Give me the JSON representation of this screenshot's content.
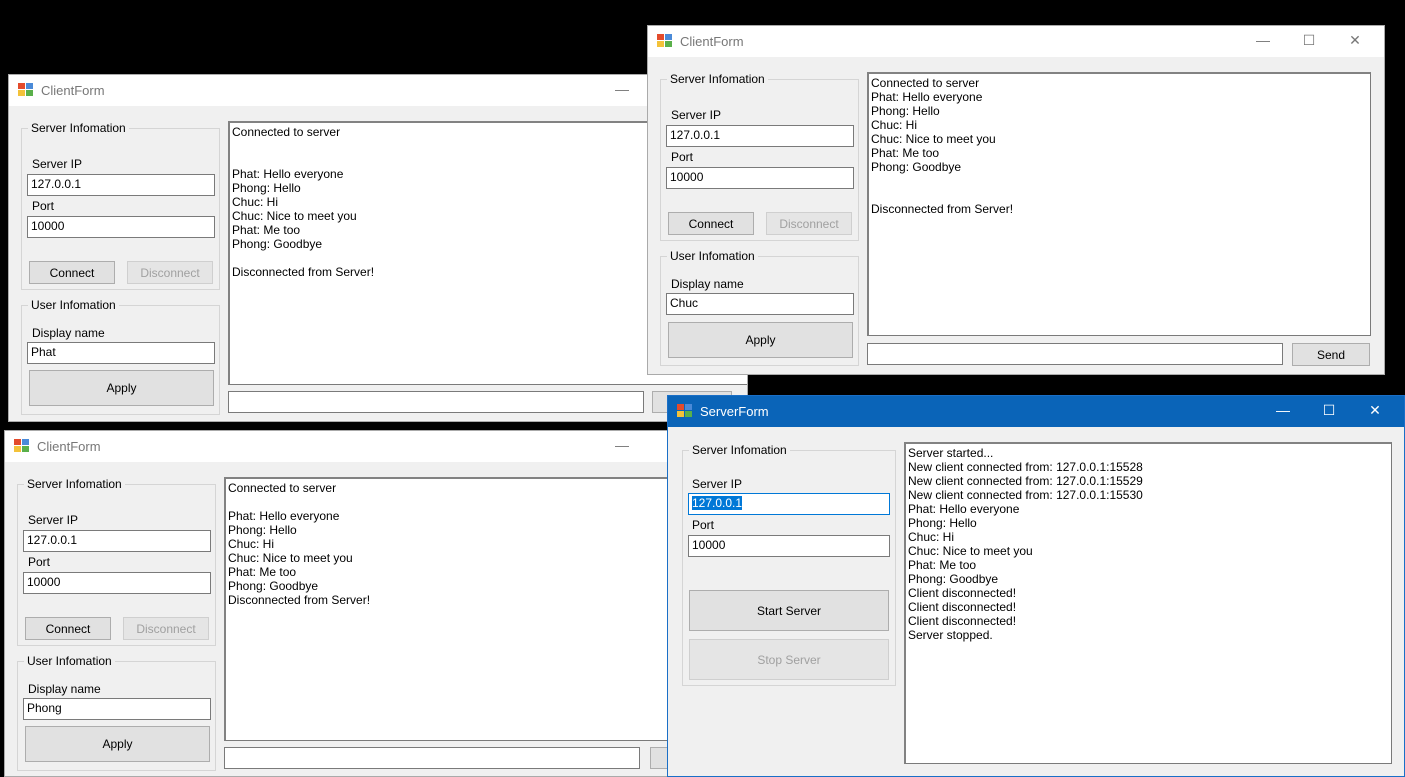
{
  "client1": {
    "title": "ClientForm",
    "min_glyph": "—",
    "server_group": "Server Infomation",
    "server_ip_label": "Server IP",
    "server_ip": "127.0.0.1",
    "port_label": "Port",
    "port": "10000",
    "connect": "Connect",
    "disconnect": "Disconnect",
    "user_group": "User Infomation",
    "display_name_label": "Display name",
    "display_name": "Phat",
    "apply": "Apply",
    "log": [
      "Connected to server",
      "",
      "",
      "Phat: Hello everyone",
      "Phong: Hello",
      "Chuc: Hi",
      "Chuc: Nice to meet you",
      "Phat: Me too",
      "Phong: Goodbye",
      "",
      "Disconnected from Server!"
    ],
    "message": ""
  },
  "client2": {
    "title": "ClientForm",
    "min_glyph": "—",
    "max_glyph": "☐",
    "close_glyph": "✕",
    "server_group": "Server Infomation",
    "server_ip_label": "Server IP",
    "server_ip": "127.0.0.1",
    "port_label": "Port",
    "port": "10000",
    "connect": "Connect",
    "disconnect": "Disconnect",
    "user_group": "User Infomation",
    "display_name_label": "Display name",
    "display_name": "Chuc",
    "apply": "Apply",
    "send": "Send",
    "log": [
      "Connected to server",
      "Phat: Hello everyone",
      "Phong: Hello",
      "Chuc: Hi",
      "Chuc: Nice to meet you",
      "Phat: Me too",
      "Phong: Goodbye",
      "",
      "",
      "Disconnected from Server!"
    ],
    "message": ""
  },
  "client3": {
    "title": "ClientForm",
    "min_glyph": "—",
    "server_group": "Server Infomation",
    "server_ip_label": "Server IP",
    "server_ip": "127.0.0.1",
    "port_label": "Port",
    "port": "10000",
    "connect": "Connect",
    "disconnect": "Disconnect",
    "user_group": "User Infomation",
    "display_name_label": "Display name",
    "display_name": "Phong",
    "apply": "Apply",
    "log": [
      "Connected to server",
      "",
      "Phat: Hello everyone",
      "Phong: Hello",
      "Chuc: Hi",
      "Chuc: Nice to meet you",
      "Phat: Me too",
      "Phong: Goodbye",
      "Disconnected from Server!"
    ],
    "message": ""
  },
  "server": {
    "title": "ServerForm",
    "min_glyph": "—",
    "max_glyph": "☐",
    "close_glyph": "✕",
    "server_group": "Server Infomation",
    "server_ip_label": "Server IP",
    "server_ip": "127.0.0.1",
    "port_label": "Port",
    "port": "10000",
    "start": "Start Server",
    "stop": "Stop Server",
    "log": [
      "Server started...",
      "New client connected from: 127.0.0.1:15528",
      "New client connected from: 127.0.0.1:15529",
      "New client connected from: 127.0.0.1:15530",
      "Phat: Hello everyone",
      "Phong: Hello",
      "Chuc: Hi",
      "Chuc: Nice to meet you",
      "Phat: Me too",
      "Phong: Goodbye",
      "Client disconnected!",
      "Client disconnected!",
      "Client disconnected!",
      "Server stopped."
    ]
  },
  "colors": {
    "titlebar_active": "#0a64b8",
    "selection": "#0078d7",
    "desktop": "#000000"
  }
}
